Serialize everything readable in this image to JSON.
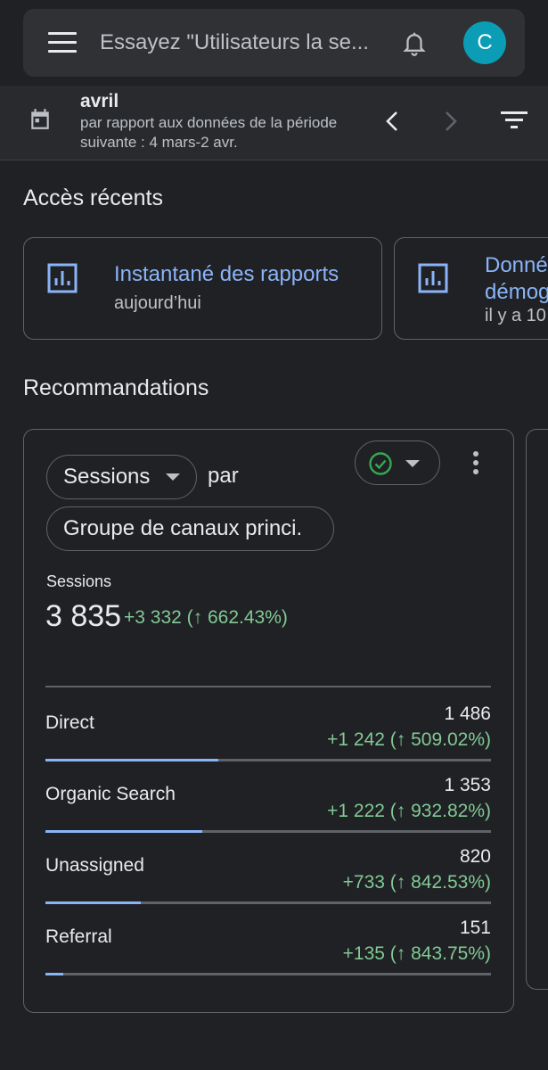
{
  "search": {
    "placeholder": "Essayez \"Utilisateurs la se...",
    "avatar_letter": "C"
  },
  "date_range": {
    "month": "avril",
    "comparison": "par rapport aux données de la période suivante : 4 mars-2 avr."
  },
  "recent": {
    "title": "Accès récents",
    "cards": [
      {
        "title": "Instantané des rapports",
        "subtitle": "aujourd’hui"
      },
      {
        "title": "Donné\ndémog",
        "subtitle": "il y a 10"
      }
    ]
  },
  "recommendations": {
    "title": "Recommandations",
    "card": {
      "metric_chip": "Sessions",
      "by_label": "par",
      "dimension_chip": "Groupe de canaux princi.",
      "metric_label": "Sessions",
      "total_value": "3 835",
      "total_delta": "+3 332 (↑ 662.43%)",
      "rows": [
        {
          "name": "Direct",
          "value": "1 486",
          "delta": "+1 242 (↑ 509.02%)",
          "share": 1486
        },
        {
          "name": "Organic Search",
          "value": "1 353",
          "delta": "+1 222 (↑ 932.82%)",
          "share": 1353
        },
        {
          "name": "Unassigned",
          "value": "820",
          "delta": "+733 (↑ 842.53%)",
          "share": 820
        },
        {
          "name": "Referral",
          "value": "151",
          "delta": "+135 (↑ 843.75%)",
          "share": 151
        }
      ],
      "max_for_bars": 3835
    }
  },
  "colors": {
    "accent": "#8ab4f8",
    "positive": "#81c995",
    "avatar": "#0a9db5",
    "status_check": "#34a853"
  },
  "icons": [
    "menu-icon",
    "bell-icon",
    "calendar-icon",
    "chevron-left-icon",
    "chevron-right-icon",
    "filter-icon",
    "report-icon",
    "check-circle-icon",
    "more-vert-icon"
  ]
}
